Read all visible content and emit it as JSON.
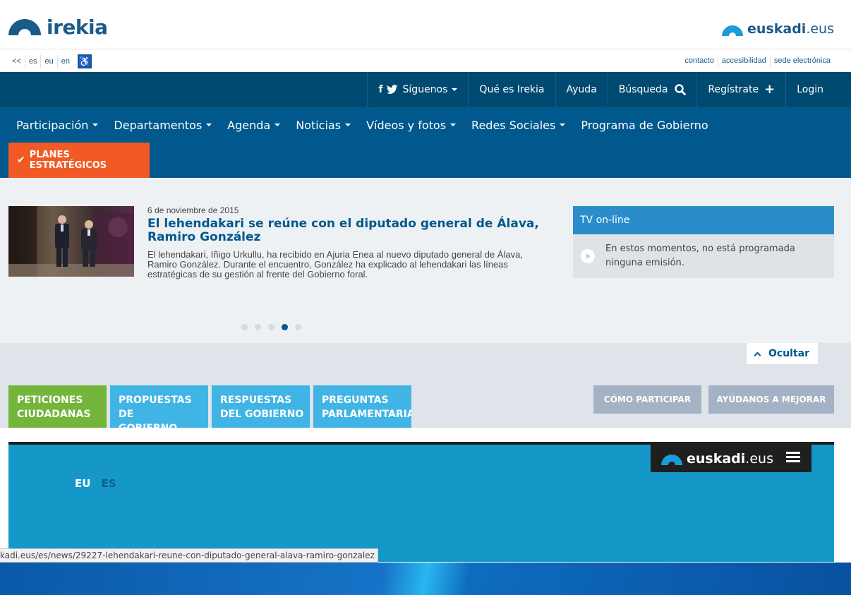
{
  "header": {
    "logo_text": "irekia",
    "euskadi_main": "euskadi",
    "euskadi_suffix": ".eus"
  },
  "lang_bar": {
    "back": "<<",
    "langs": [
      "es",
      "eu",
      "en"
    ],
    "links": [
      "contacto",
      "accesibilidad",
      "sede electrónica"
    ]
  },
  "top_nav": {
    "social": "Síguenos",
    "items": [
      "Qué es Irekia",
      "Ayuda",
      "Búsqueda",
      "Regístrate",
      "Login"
    ]
  },
  "main_menu": {
    "items": [
      "Participación",
      "Departamentos",
      "Agenda",
      "Noticias",
      "Vídeos y fotos",
      "Redes Sociales",
      "Programa de Gobierno"
    ],
    "highlight": "PLANES ESTRATÉGICOS"
  },
  "featured": {
    "date": "6 de noviembre de 2015",
    "title": "El lehendakari se reúne con el diputado general de Álava, Ramiro González",
    "body": "El lehendakari, Iñigo Urkullu, ha recibido en Ajuria Enea al nuevo diputado general de Álava, Ramiro González. Durante el encuentro, González ha explicado al lehendakari las líneas estratégicas de su gestión al frente del Gobierno foral.",
    "slide_count": 5,
    "active_slide": 4
  },
  "tv": {
    "title": "TV on-line",
    "message": "En estos momentos, no está programada ninguna emisión."
  },
  "participation": {
    "hide_label": "Ocultar",
    "tabs": [
      {
        "line1": "PETICIONES",
        "line2": "CIUDADANAS"
      },
      {
        "line1": "PROPUESTAS DE",
        "line2": "GOBIERNO"
      },
      {
        "line1": "RESPUESTAS",
        "line2": "DEL GOBIERNO"
      },
      {
        "line1": "PREGUNTAS",
        "line2": "PARLAMENTARIAS"
      }
    ],
    "buttons": [
      "CÓMO PARTICIPAR",
      "AYÚDANOS A MEJORAR"
    ]
  },
  "embed": {
    "euskadi_main": "euskadi",
    "euskadi_suffix": ".eus",
    "lang_eu": "EU",
    "lang_es": "ES"
  },
  "status_url": "kadi.eus/es/news/29227-lehendakari-reune-con-diputado-general-alava-ramiro-gonzalez",
  "colors": {
    "brand_dark": "#004a72",
    "brand": "#00588c",
    "orange": "#f15a24",
    "green": "#74b53c",
    "light_blue": "#41b4e6"
  }
}
